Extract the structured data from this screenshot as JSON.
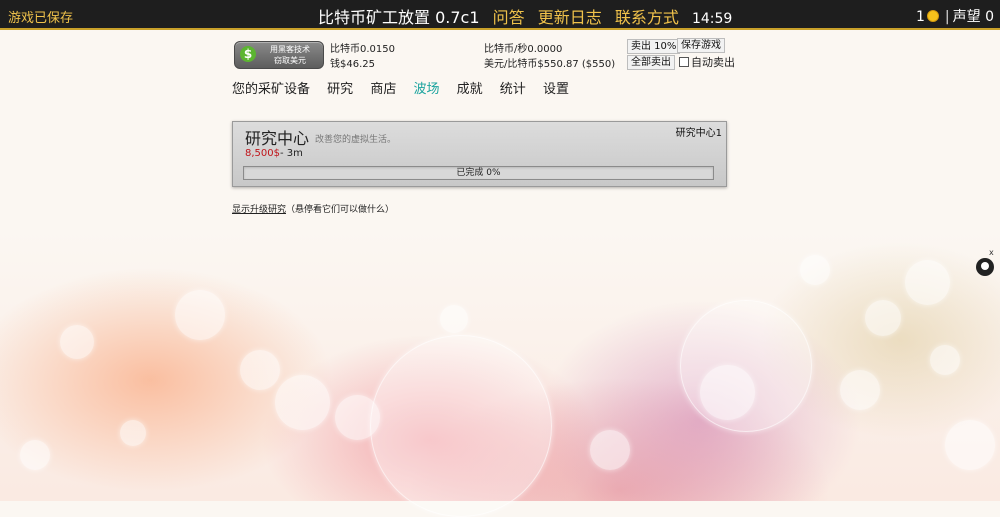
{
  "topbar": {
    "save_status": "游戏已保存",
    "title": "比特币矿工放置 0.7c1",
    "links": [
      "问答",
      "更新日志",
      "联系方式"
    ],
    "clock": "14:59",
    "coins": "1",
    "reputation": "声望 0"
  },
  "cash_button": {
    "line1": "用黑客技术",
    "line2": "窃取美元",
    "icon": "dollar-icon"
  },
  "stats": {
    "bitcoin": "比特币0.0150",
    "money": "钱$46.25",
    "rate": "比特币/秒0.0000",
    "price": "美元/比特币$550.87 ($550)"
  },
  "actions": {
    "sell10": "卖出 10%",
    "save_game": "保存游戏",
    "sell_all": "全部卖出",
    "auto_sell": "自动卖出"
  },
  "nav": [
    "您的采矿设备",
    "研究",
    "商店",
    "波场",
    "成就",
    "统计",
    "设置"
  ],
  "nav_active": "波场",
  "research_panel": {
    "name": "研究中心",
    "description": "改善您的虚拟生活。",
    "count": "研究中心1",
    "cost": "8,500$",
    "duration": "- 3m",
    "progress_label": "已完成 0%",
    "progress_fraction": 0
  },
  "upgrades": {
    "link": "显示升级研究",
    "hint": "（悬停看它们可以做什么）"
  },
  "side": {
    "close": "x",
    "icon": "github-icon"
  }
}
